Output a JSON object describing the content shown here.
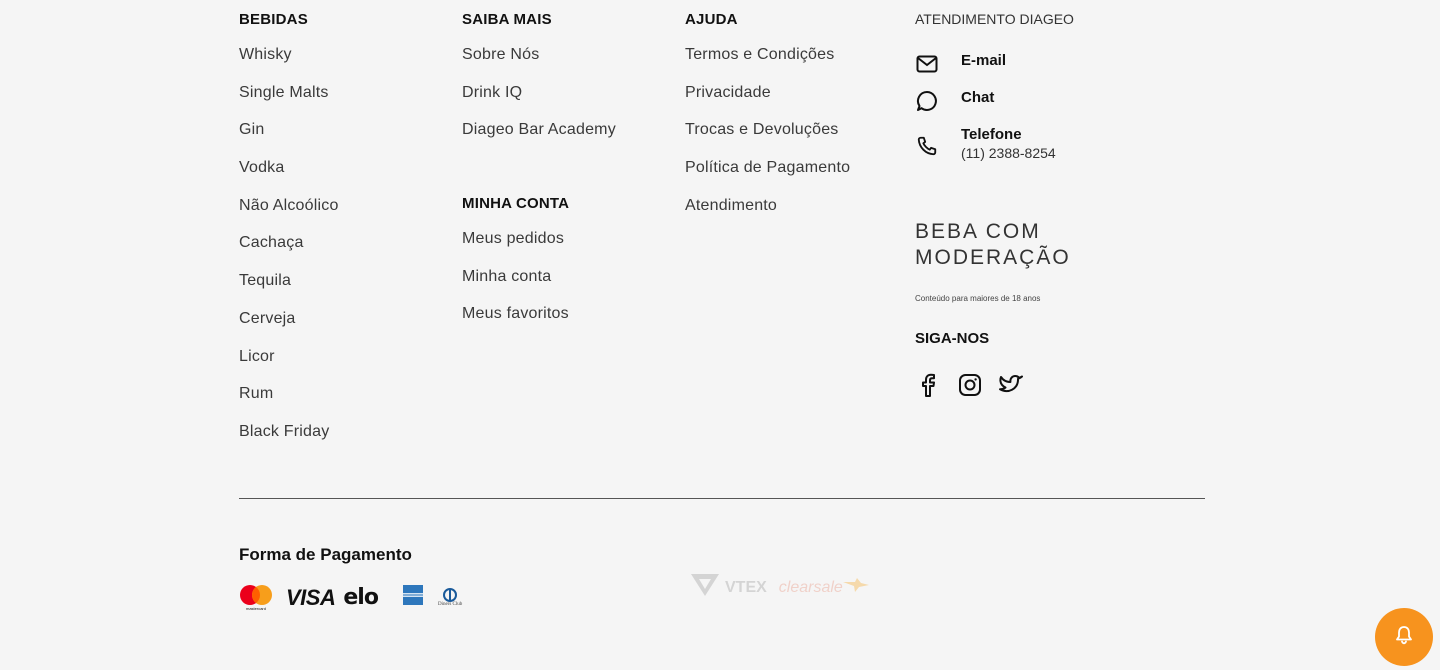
{
  "columns": {
    "bebidas": {
      "title": "BEBIDAS",
      "links": [
        "Whisky",
        "Single Malts",
        "Gin",
        "Vodka",
        "Não Alcoólico",
        "Cachaça",
        "Tequila",
        "Cerveja",
        "Licor",
        "Rum",
        "Black Friday"
      ]
    },
    "saiba_mais": {
      "title": "SAIBA MAIS",
      "links": [
        "Sobre Nós",
        "Drink IQ",
        "Diageo Bar Academy"
      ]
    },
    "minha_conta": {
      "title": "MINHA CONTA",
      "links": [
        "Meus pedidos",
        "Minha conta",
        "Meus favoritos"
      ]
    },
    "ajuda": {
      "title": "AJUDA",
      "links": [
        "Termos e Condições",
        "Privacidade",
        "Trocas e Devoluções",
        "Política de Pagamento",
        "Atendimento"
      ]
    }
  },
  "atendimento": {
    "title": "ATENDIMENTO DIAGEO",
    "email_label": "E-mail",
    "chat_label": "Chat",
    "phone_label": "Telefone",
    "phone_number": "(11) 2388-8254"
  },
  "moderacao": {
    "line1": "BEBA COM",
    "line2": "MODERAÇÃO",
    "age_note": "Conteúdo para maiores de 18 anos"
  },
  "social": {
    "title": "SIGA-NOS",
    "icons": [
      "facebook-icon",
      "instagram-icon",
      "twitter-icon"
    ]
  },
  "payment": {
    "title": "Forma de Pagamento",
    "brands": [
      "mastercard",
      "VISA",
      "elo",
      "american-express",
      "Diners Club"
    ],
    "mastercard_caption": "mastercard",
    "visa_label": "VISA",
    "elo_label": "elo",
    "diners_caption": "Diners Club"
  },
  "partners": {
    "vtex_label": "VTEX",
    "clearsale_label": "clearsale"
  },
  "colors": {
    "background": "#f5f5f5",
    "accent_orange": "#f7931e",
    "text_dark": "#111111"
  }
}
